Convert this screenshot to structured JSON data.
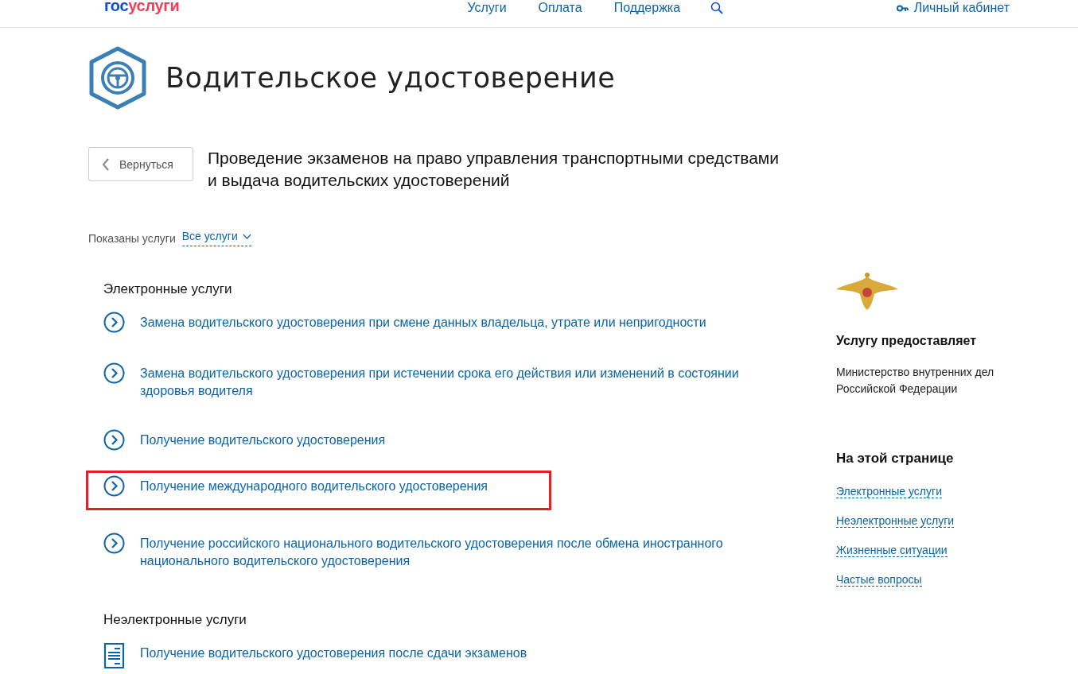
{
  "header": {
    "logo": {
      "first": "гос",
      "second": "услуги"
    },
    "nav": [
      "Услуги",
      "Оплата",
      "Поддержка"
    ],
    "account": "Личный кабинет"
  },
  "page_title": "Водительское удостоверение",
  "back_button": "Вернуться",
  "section_title": "Проведение экзаменов на право управления транспортными средствами и выдача водительских удостоверений",
  "filter": {
    "label": "Показаны услуги",
    "value": "Все услуги"
  },
  "groups": [
    {
      "title": "Электронные услуги",
      "items": [
        {
          "kind": "electronic",
          "text": "Замена водительского удостоверения при смене данных владельца, утрате или непригодности",
          "highlighted": false
        },
        {
          "kind": "electronic",
          "text": "Замена водительского удостоверения при истечении срока его действия или изменений в состоянии здоровья водителя",
          "highlighted": false
        },
        {
          "kind": "electronic",
          "text": "Получение водительского удостоверения",
          "highlighted": false
        },
        {
          "kind": "electronic",
          "text": "Получение международного водительского удостоверения",
          "highlighted": true
        },
        {
          "kind": "electronic",
          "text": "Получение российского национального водительского удостоверения после обмена иностранного национального водительского удостоверения",
          "highlighted": false
        }
      ]
    },
    {
      "title": "Неэлектронные услуги",
      "items": [
        {
          "kind": "document",
          "text": "Получение водительского удостоверения после сдачи экзаменов",
          "highlighted": false
        }
      ]
    }
  ],
  "sidebar": {
    "provider_title": "Услугу предоставляет",
    "provider": "Министерство внутренних дел Российской Федерации",
    "toc_title": "На этой странице",
    "toc": [
      "Электронные услуги",
      "Неэлектронные услуги",
      "Жизненные ситуации",
      "Частые вопросы"
    ]
  }
}
